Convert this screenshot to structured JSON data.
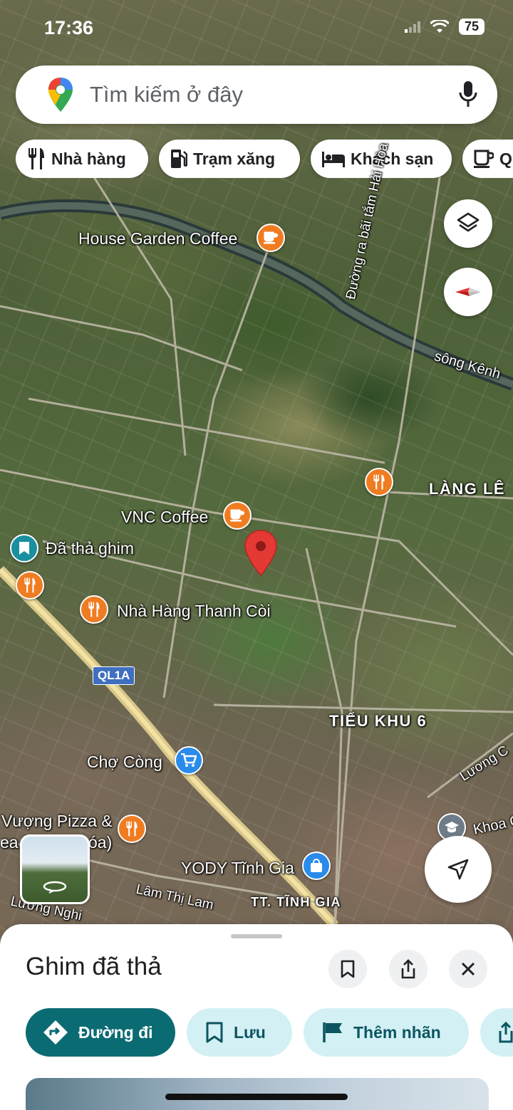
{
  "status": {
    "time": "17:36",
    "battery": "75"
  },
  "search": {
    "placeholder": "Tìm kiếm ở đây"
  },
  "chips": [
    {
      "label": "Nhà hàng",
      "icon": "restaurant-icon"
    },
    {
      "label": "Trạm xăng",
      "icon": "gas-station-icon"
    },
    {
      "label": "Khách sạn",
      "icon": "hotel-icon"
    },
    {
      "label": "Q",
      "icon": "coffee-icon"
    }
  ],
  "map": {
    "places": {
      "house_garden": "House Garden Coffee",
      "vnc": "VNC Coffee",
      "dropped_pin": "Đã thả ghim",
      "thanh_coi": "Nhà Hàng Thanh Còi",
      "cho_cong": "Chợ Còng",
      "pizza_line1": "Vượng Pizza &",
      "pizza_line2": "ea (",
      "pizza_line3": "óa)",
      "yody": "YODY Tĩnh Gia",
      "khoa": "Khoa C"
    },
    "areas": {
      "lang_le": "LÀNG LÊ",
      "tieu_khu_6": "TIỂU KHU 6",
      "tt_tinh_gia": "TT. TĨNH GIA"
    },
    "roads": {
      "duong_ra": "Đường ra bãi tắm Hải Hòa",
      "song_kenh": "sông Kênh",
      "ql1a": "QL1A",
      "lam_thi_lam": "Lâm Thị Lam",
      "luong_nghi": "Lương Nghi",
      "luong_c": "Lương C"
    }
  },
  "sheet": {
    "title": "Ghim đã thả",
    "actions": {
      "directions": "Đường đi",
      "save": "Lưu",
      "label": "Thêm nhãn"
    }
  },
  "colors": {
    "pin_red": "#e53935",
    "poi_orange": "#f07c22",
    "primary_teal": "#0b6b73",
    "secondary_teal": "#d3f0f4"
  }
}
